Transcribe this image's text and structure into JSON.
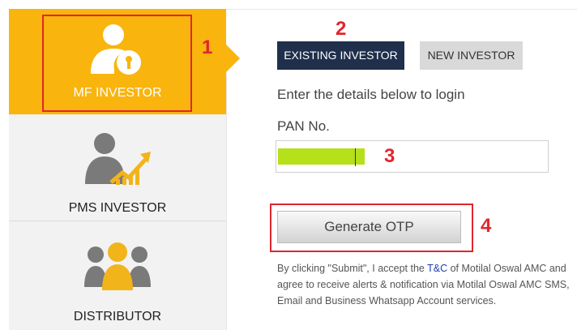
{
  "sidebar": {
    "items": [
      {
        "label": "MF INVESTOR",
        "icon": "investor-key-icon",
        "active": true
      },
      {
        "label": "PMS INVESTOR",
        "icon": "growth-investor-icon",
        "active": false
      },
      {
        "label": "DISTRIBUTOR",
        "icon": "group-people-icon",
        "active": false
      }
    ]
  },
  "tabs": {
    "existing": "EXISTING INVESTOR",
    "new": "NEW INVESTOR"
  },
  "form": {
    "instruction": "Enter the details below to login",
    "pan_label": "PAN No.",
    "pan_value": "",
    "generate_label": "Generate OTP"
  },
  "disclaimer": {
    "before": "By clicking \"Submit\", I accept the ",
    "link": "T&C",
    "after": " of Motilal Oswal AMC and agree to receive alerts & notification via Motilal Oswal AMC SMS, Email and Business Whatsapp Account services."
  },
  "annotations": [
    "1",
    "2",
    "3",
    "4"
  ],
  "colors": {
    "accent": "#f9b40e",
    "tab_active": "#1f2f4c",
    "annotation": "#e0262d",
    "redaction": "#b5e01a"
  }
}
